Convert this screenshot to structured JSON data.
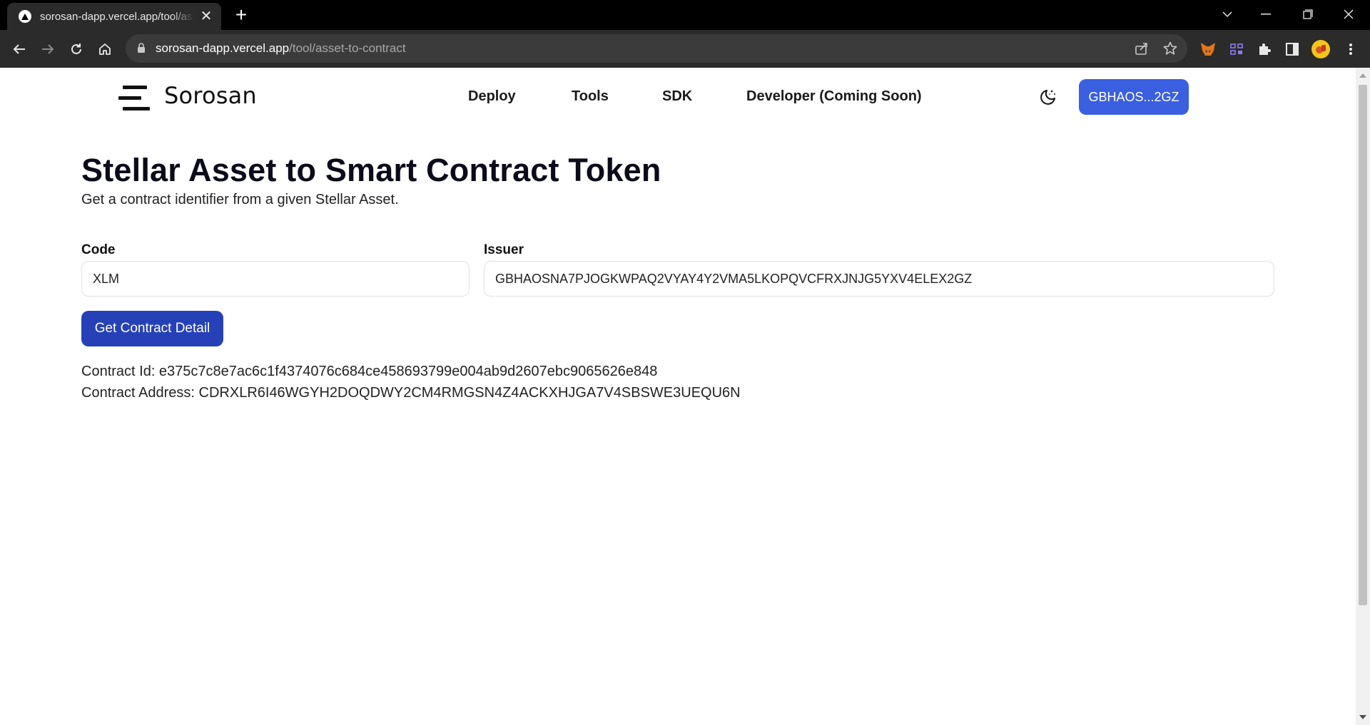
{
  "browser": {
    "tab_title": "sorosan-dapp.vercel.app/tool/asset-to-contract",
    "tab_close": "✕",
    "new_tab": "+",
    "url_host": "sorosan-dapp.vercel.app",
    "url_path": "/tool/asset-to-contract",
    "icons": [
      "back-arrow-icon",
      "forward-arrow-icon",
      "reload-icon",
      "home-icon",
      "lock-icon",
      "share-icon",
      "star-icon",
      "metamask-icon",
      "extension-icon",
      "puzzle-icon",
      "side-panel-icon",
      "profile-avatar-icon",
      "kebab-menu-icon"
    ]
  },
  "header": {
    "brand": "Sorosan",
    "nav": [
      "Deploy",
      "Tools",
      "SDK",
      "Developer (Coming Soon)"
    ],
    "wallet_label": "GBHAOS...2GZ"
  },
  "main": {
    "title": "Stellar Asset to Smart Contract Token",
    "subtitle": "Get a contract identifier from a given Stellar Asset.",
    "code_label": "Code",
    "code_value": "XLM",
    "issuer_label": "Issuer",
    "issuer_value": "GBHAOSNA7PJOGKWPAQ2VYAY4Y2VMA5LKOPQVCFRXJNJG5YXV4ELEX2GZ",
    "button_label": "Get Contract Detail",
    "contract_id_line": "Contract Id: e375c7c8e7ac6c1f4374076c684ce458693799e004ab9d2607ebc9065626e848",
    "contract_address_line": "Contract Address: CDRXLR6I46WGYH2DOQDWY2CM4RMGSN4Z4ACKXHJGA7V4SBSWE3UEQU6N"
  },
  "colors": {
    "wallet_button": "#3a5fe0",
    "primary_button": "#2641b8",
    "title_text": "#0b0b1a"
  }
}
